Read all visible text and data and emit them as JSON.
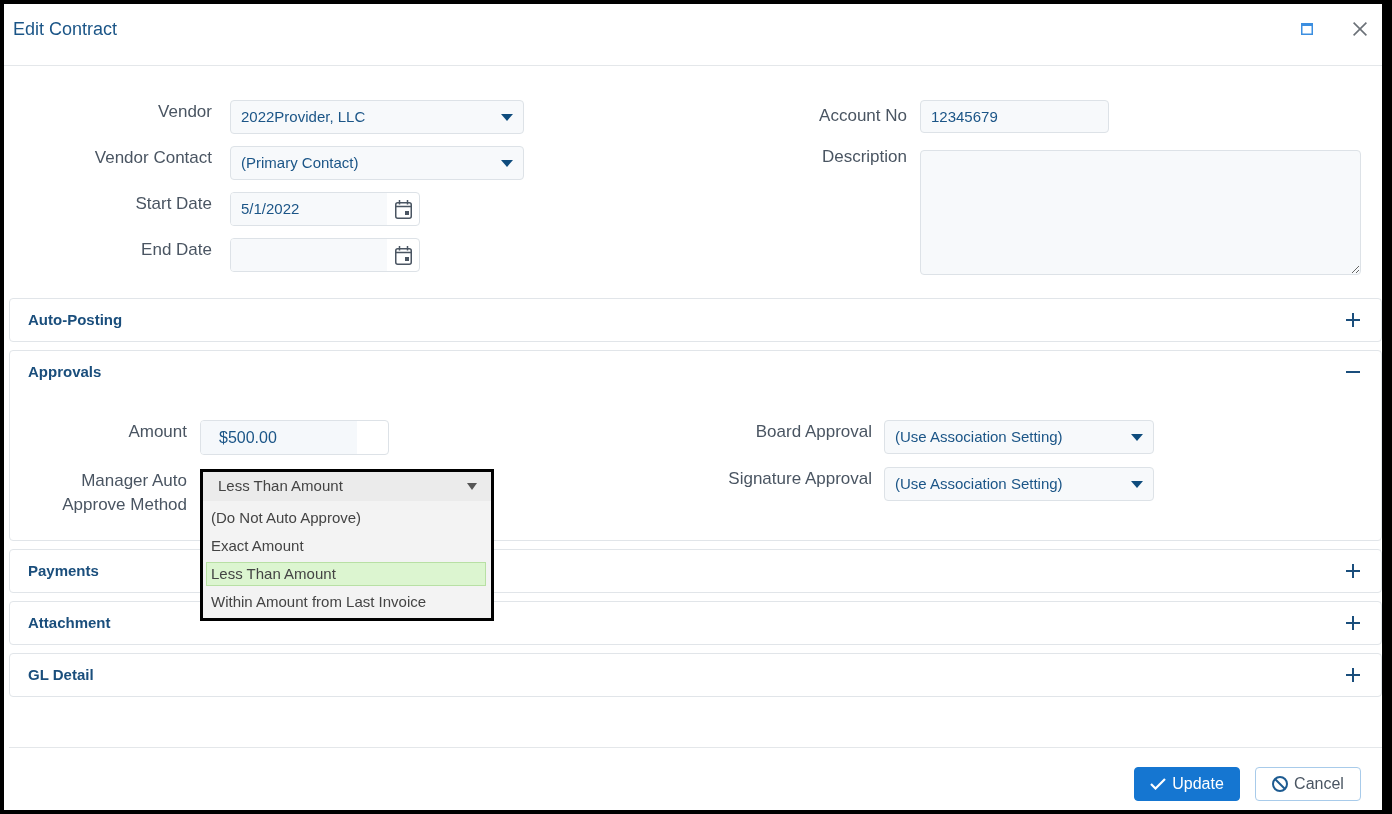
{
  "window": {
    "title": "Edit Contract"
  },
  "form": {
    "left": [
      {
        "kind": "select",
        "label": "Vendor",
        "value": "2022Provider, LLC",
        "expanded": false
      },
      {
        "kind": "select",
        "label": "Vendor Contact",
        "value": "(Primary Contact)",
        "expanded": false
      },
      {
        "kind": "date",
        "label": "Start Date",
        "value": "5/1/2022"
      },
      {
        "kind": "date",
        "label": "End Date"
      }
    ],
    "right": [
      {
        "kind": "text",
        "label": "Account No",
        "value": "12345679"
      },
      {
        "kind": "textarea",
        "label": "Description"
      }
    ]
  },
  "sections": [
    {
      "title": "Auto-Posting",
      "expanded": false
    },
    {
      "title": "Approvals",
      "expanded": true,
      "left": [
        {
          "kind": "amount",
          "label": "Amount",
          "value": "$500.00"
        },
        {
          "kind": "select",
          "label": "Manager Auto Approve Method",
          "value": "Less Than Amount",
          "expanded": true,
          "options": [
            {
              "label": "(Do Not Auto Approve)",
              "selected": false
            },
            {
              "label": "Exact Amount",
              "selected": false
            },
            {
              "label": "Less Than Amount",
              "selected": true
            },
            {
              "label": "Within Amount from Last Invoice",
              "selected": false
            }
          ]
        }
      ],
      "right": [
        {
          "kind": "select",
          "label": "Board Approval",
          "value": "(Use Association Setting)",
          "expanded": false
        },
        {
          "kind": "select",
          "label": "Signature Approval",
          "value": "(Use Association Setting)",
          "expanded": false
        }
      ]
    },
    {
      "title": "Payments",
      "expanded": false
    },
    {
      "title": "Attachment",
      "expanded": false
    },
    {
      "title": "GL Detail",
      "expanded": false
    }
  ],
  "buttons": [
    {
      "kind": "primary",
      "label": "Update"
    },
    {
      "kind": "secondary",
      "label": "Cancel"
    }
  ]
}
